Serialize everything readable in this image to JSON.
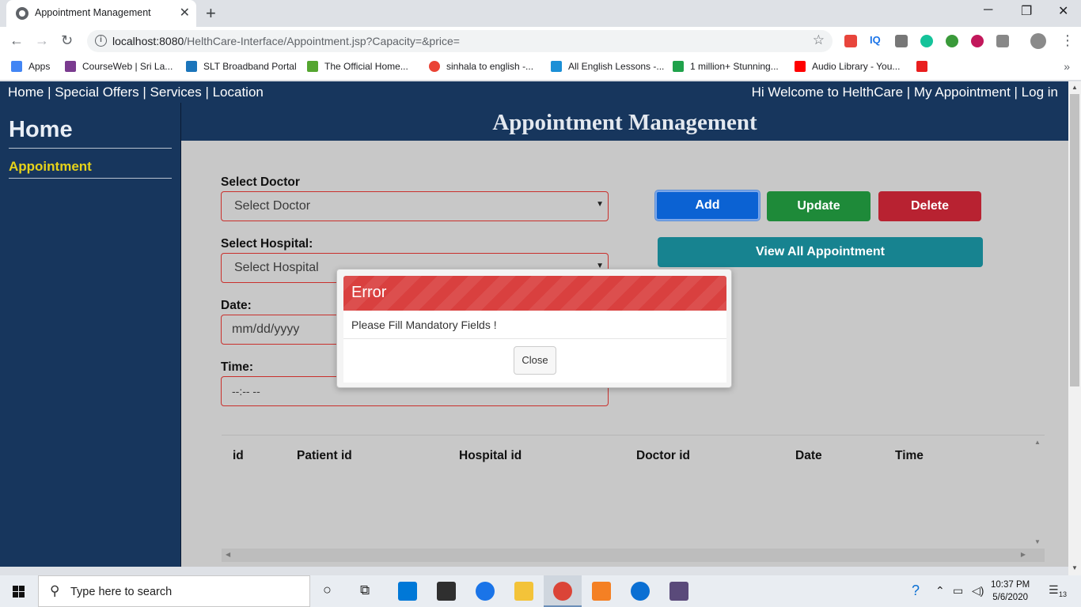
{
  "browser": {
    "tab_title": "Appointment Management",
    "url_host": "localhost:8080",
    "url_path": "/HelthCare-Interface/Appointment.jsp?Capacity=&price=",
    "bookmarks": [
      {
        "label": "Apps",
        "color": "#4285f4"
      },
      {
        "label": "CourseWeb | Sri La...",
        "color": "#7a3b8f"
      },
      {
        "label": "SLT Broadband Portal",
        "color": "#1b75bb"
      },
      {
        "label": "The Official Home...",
        "color": "#55a630"
      },
      {
        "label": "sinhala to english -...",
        "color": "#ea4335"
      },
      {
        "label": "All English Lessons -...",
        "color": "#1b8fd6"
      },
      {
        "label": "1 million+ Stunning...",
        "color": "#20a24b"
      },
      {
        "label": "Audio Library - You...",
        "color": "#ff0000"
      }
    ]
  },
  "page": {
    "nav_left": "Home | Special Offers | Services | Location",
    "nav_right": "Hi Welcome to HelthCare | My Appointment | Log in",
    "sidebar_title": "Home",
    "sidebar_item": "Appointment",
    "heading": "Appointment Management",
    "form": {
      "doctor_label": "Select Doctor",
      "doctor_value": "Select Doctor",
      "hospital_label": "Select Hospital:",
      "hospital_value": "Select Hospital",
      "date_label": "Date:",
      "date_placeholder": "mm/dd/yyyy",
      "time_label": "Time:",
      "time_placeholder": "--:-- --"
    },
    "buttons": {
      "add": "Add",
      "update": "Update",
      "delete": "Delete",
      "view_all": "View All Appointment"
    },
    "table_headers": [
      "id",
      "Patient id",
      "Hospital id",
      "Doctor id",
      "Date",
      "Time"
    ]
  },
  "modal": {
    "title": "Error",
    "message": "Please Fill Mandatory Fields !",
    "close": "Close"
  },
  "taskbar": {
    "search_placeholder": "Type here to search",
    "time": "10:37 PM",
    "date": "5/6/2020",
    "notifications": "13"
  },
  "colors": {
    "nav_bg": "#17365d",
    "accent_yellow": "#e6d21a",
    "add_btn": "#0b62d3",
    "update_btn": "#1e8a39",
    "delete_btn": "#b82231",
    "view_btn": "#178390",
    "error_header": "#d9403f"
  }
}
